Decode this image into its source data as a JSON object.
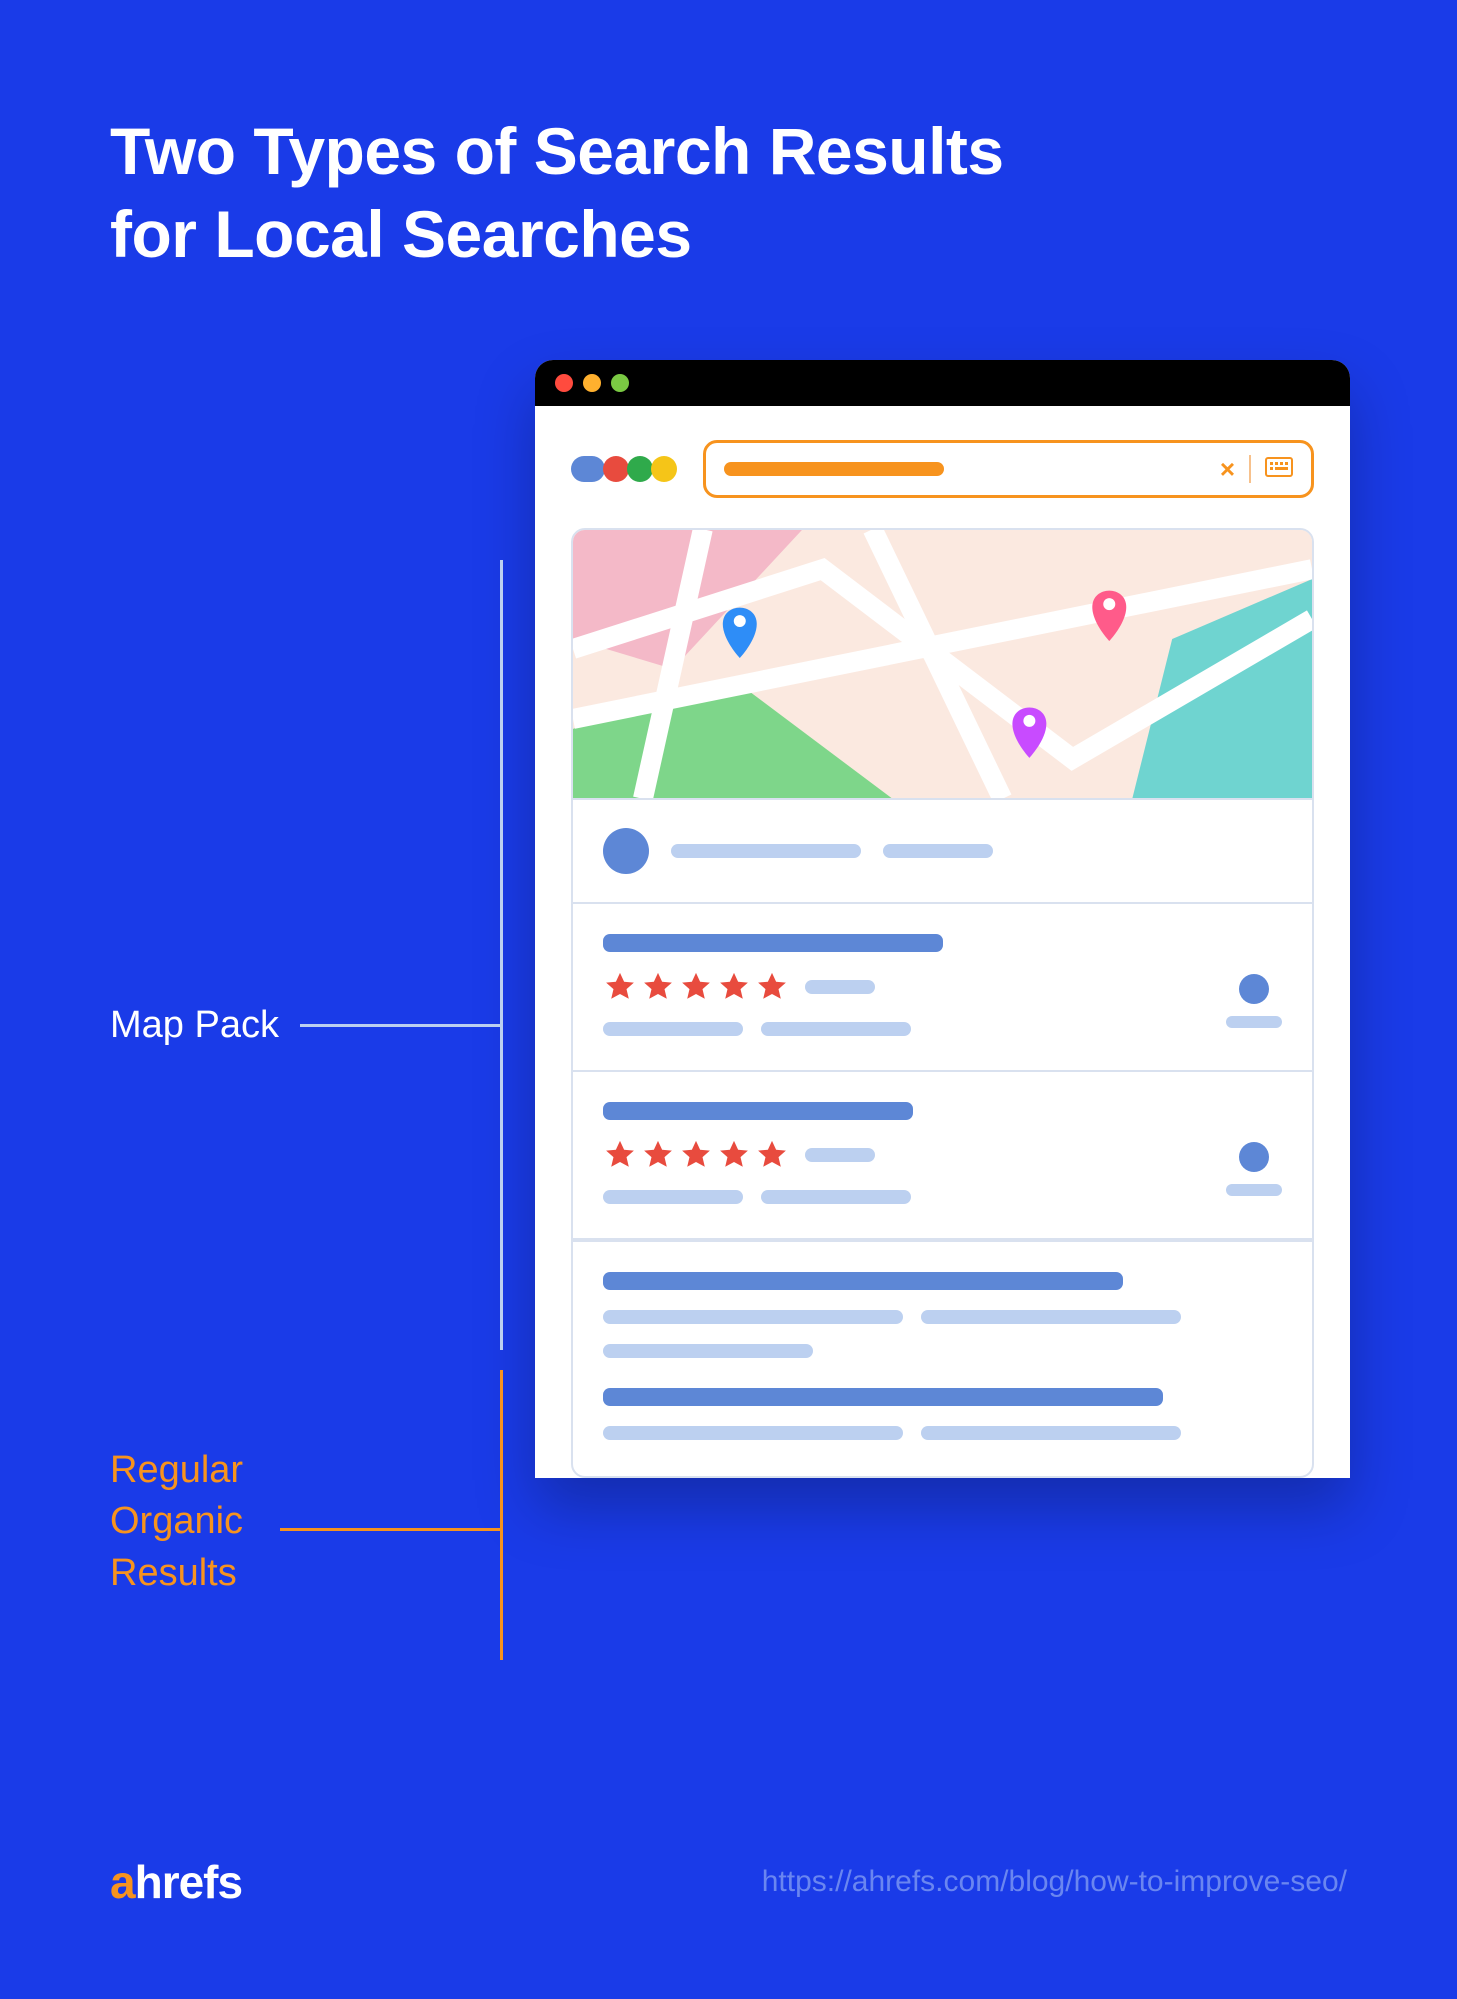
{
  "title_line1": "Two Types of Search Results",
  "title_line2": "for Local Searches",
  "annotations": {
    "map_pack": "Map Pack",
    "organic_line1": "Regular",
    "organic_line2": "Organic",
    "organic_line3": "Results"
  },
  "footer": {
    "brand_a": "a",
    "brand_rest": "hrefs",
    "url": "https://ahrefs.com/blog/how-to-improve-seo/"
  },
  "colors": {
    "page_bg": "#1a3be8",
    "orange": "#f7931e",
    "blue_med": "#5d87d6",
    "blue_light": "#bcd0f0",
    "star_red": "#e84b3e"
  },
  "icons": {
    "traffic_red": "close-icon",
    "traffic_amber": "minimize-icon",
    "traffic_green": "maximize-icon",
    "search_clear": "close-icon",
    "keyboard": "keyboard-icon",
    "map_pin_blue": "map-pin-icon",
    "map_pin_pink": "map-pin-icon",
    "map_pin_purple": "map-pin-icon",
    "star": "star-icon"
  }
}
